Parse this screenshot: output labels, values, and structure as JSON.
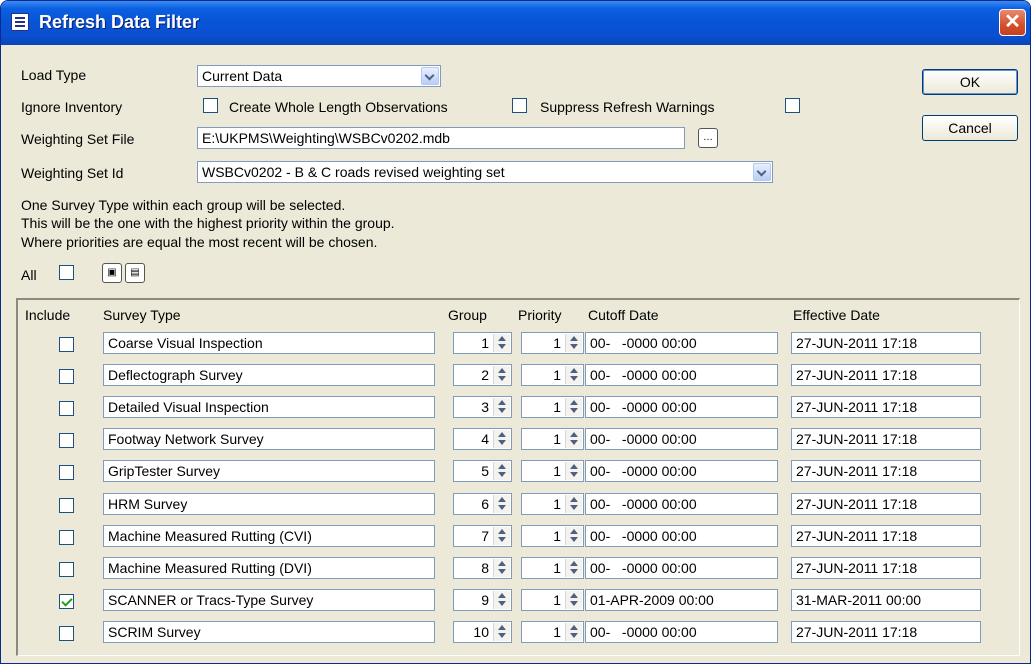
{
  "window": {
    "title": "Refresh Data Filter",
    "close_glyph": "✕"
  },
  "form": {
    "load_type_label": "Load Type",
    "load_type_value": "Current Data",
    "ignore_inventory_label": "Ignore Inventory",
    "create_whole_length_label": "Create Whole Length Observations",
    "suppress_refresh_label": "Suppress Refresh Warnings",
    "weighting_set_file_label": "Weighting Set File",
    "weighting_set_file_value": "E:\\UKPMS\\Weighting\\WSBCv0202.mdb",
    "weighting_set_id_label": "Weighting Set Id",
    "weighting_set_id_value": "WSBCv0202 - B & C roads revised weighting set",
    "info_line1": "One Survey Type within each group will be selected.",
    "info_line2": "This will be the one with the highest priority within the group.",
    "info_line3": "Where priorities are equal the most recent will be chosen.",
    "all_label": "All"
  },
  "buttons": {
    "ok": "OK",
    "cancel": "Cancel"
  },
  "grid": {
    "headers": {
      "include": "Include",
      "survey_type": "Survey Type",
      "group": "Group",
      "priority": "Priority",
      "cutoff_date": "Cutoff Date",
      "effective_date": "Effective Date"
    },
    "rows": [
      {
        "include": false,
        "survey_type": "Coarse Visual Inspection",
        "group": "1",
        "priority": "1",
        "cutoff": "00-   -0000 00:00",
        "effective": "27-JUN-2011 17:18"
      },
      {
        "include": false,
        "survey_type": "Deflectograph Survey",
        "group": "2",
        "priority": "1",
        "cutoff": "00-   -0000 00:00",
        "effective": "27-JUN-2011 17:18"
      },
      {
        "include": false,
        "survey_type": "Detailed Visual Inspection",
        "group": "3",
        "priority": "1",
        "cutoff": "00-   -0000 00:00",
        "effective": "27-JUN-2011 17:18"
      },
      {
        "include": false,
        "survey_type": "Footway Network Survey",
        "group": "4",
        "priority": "1",
        "cutoff": "00-   -0000 00:00",
        "effective": "27-JUN-2011 17:18"
      },
      {
        "include": false,
        "survey_type": "GripTester Survey",
        "group": "5",
        "priority": "1",
        "cutoff": "00-   -0000 00:00",
        "effective": "27-JUN-2011 17:18"
      },
      {
        "include": false,
        "survey_type": "HRM Survey",
        "group": "6",
        "priority": "1",
        "cutoff": "00-   -0000 00:00",
        "effective": "27-JUN-2011 17:18"
      },
      {
        "include": false,
        "survey_type": "Machine Measured Rutting (CVI)",
        "group": "7",
        "priority": "1",
        "cutoff": "00-   -0000 00:00",
        "effective": "27-JUN-2011 17:18"
      },
      {
        "include": false,
        "survey_type": "Machine Measured Rutting (DVI)",
        "group": "8",
        "priority": "1",
        "cutoff": "00-   -0000 00:00",
        "effective": "27-JUN-2011 17:18"
      },
      {
        "include": true,
        "survey_type": "SCANNER or Tracs-Type Survey",
        "group": "9",
        "priority": "1",
        "cutoff": "01-APR-2009 00:00",
        "effective": "31-MAR-2011 00:00"
      },
      {
        "include": false,
        "survey_type": "SCRIM Survey",
        "group": "10",
        "priority": "1",
        "cutoff": "00-   -0000 00:00",
        "effective": "27-JUN-2011 17:18"
      }
    ]
  }
}
